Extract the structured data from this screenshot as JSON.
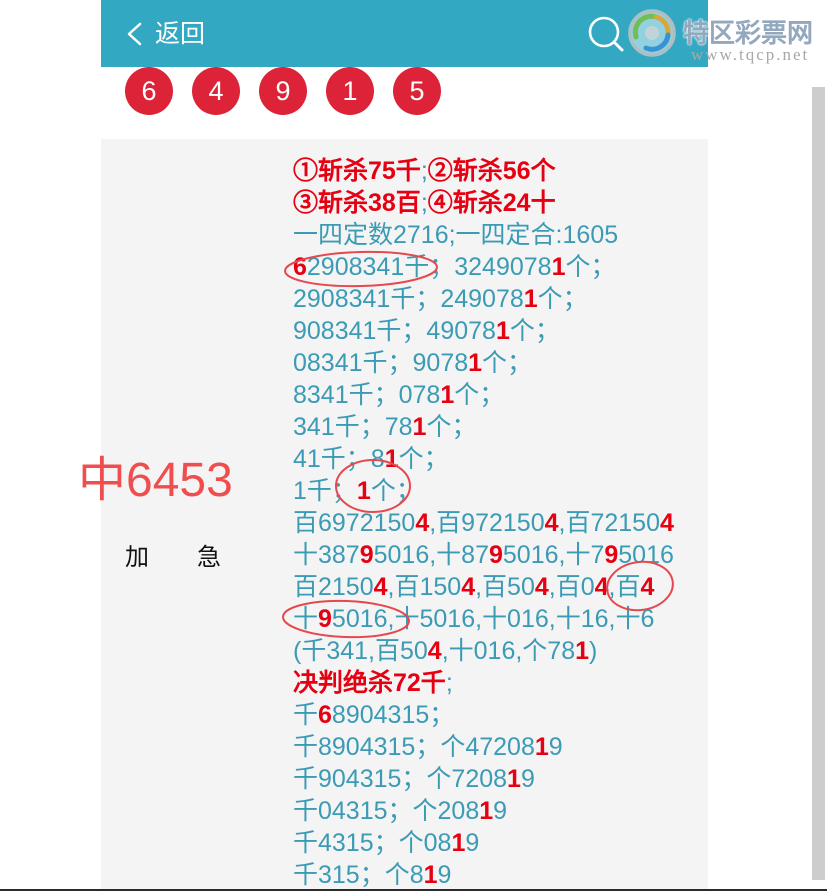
{
  "header": {
    "back_label": "返回"
  },
  "watermark": {
    "name": "特区彩票网",
    "url": "www.tqcp.net"
  },
  "icons": {
    "back": "chevron-left-icon",
    "search": "search-icon",
    "logo": "logo-icon"
  },
  "balls": [
    "6",
    "4",
    "9",
    "1",
    "5"
  ],
  "panel": {
    "label": "加　急",
    "stamp": "中6453",
    "lines": [
      [
        {
          "text": "①斩杀75千",
          "hl": true
        },
        {
          "text": ";",
          "hl": false
        },
        {
          "text": "②斩杀56个",
          "hl": true
        }
      ],
      [
        {
          "text": "③斩杀38百",
          "hl": true
        },
        {
          "text": ";",
          "hl": false
        },
        {
          "text": "④斩杀24十",
          "hl": true
        }
      ],
      [
        {
          "text": "一四定数2716;一四定合:1605",
          "hl": false
        }
      ],
      [
        {
          "text": "6",
          "hl": true
        },
        {
          "text": "2908341千；3249078",
          "hl": false
        },
        {
          "text": "1",
          "hl": true
        },
        {
          "text": "个；",
          "hl": false
        }
      ],
      [
        {
          "text": "2908341千；249078",
          "hl": false
        },
        {
          "text": "1",
          "hl": true
        },
        {
          "text": "个；",
          "hl": false
        }
      ],
      [
        {
          "text": "908341千；49078",
          "hl": false
        },
        {
          "text": "1",
          "hl": true
        },
        {
          "text": "个；",
          "hl": false
        }
      ],
      [
        {
          "text": "08341千；9078",
          "hl": false
        },
        {
          "text": "1",
          "hl": true
        },
        {
          "text": "个；",
          "hl": false
        }
      ],
      [
        {
          "text": "8341千；078",
          "hl": false
        },
        {
          "text": "1",
          "hl": true
        },
        {
          "text": "个；",
          "hl": false
        }
      ],
      [
        {
          "text": "341千；78",
          "hl": false
        },
        {
          "text": "1",
          "hl": true
        },
        {
          "text": "个；",
          "hl": false
        }
      ],
      [
        {
          "text": "41千；8",
          "hl": false
        },
        {
          "text": "1",
          "hl": true
        },
        {
          "text": "个；",
          "hl": false
        }
      ],
      [
        {
          "text": "1千；",
          "hl": false
        },
        {
          "text": "1",
          "hl": true
        },
        {
          "text": "个；",
          "hl": false
        }
      ],
      [
        {
          "text": "百6972150",
          "hl": false
        },
        {
          "text": "4",
          "hl": true
        },
        {
          "text": ",百972150",
          "hl": false
        },
        {
          "text": "4",
          "hl": true
        },
        {
          "text": ",百72150",
          "hl": false
        },
        {
          "text": "4",
          "hl": true
        }
      ],
      [
        {
          "text": "十387",
          "hl": false
        },
        {
          "text": "9",
          "hl": true
        },
        {
          "text": "5016,十87",
          "hl": false
        },
        {
          "text": "9",
          "hl": true
        },
        {
          "text": "5016,十7",
          "hl": false
        },
        {
          "text": "9",
          "hl": true
        },
        {
          "text": "5016",
          "hl": false
        }
      ],
      [
        {
          "text": "百2150",
          "hl": false
        },
        {
          "text": "4",
          "hl": true
        },
        {
          "text": ",百150",
          "hl": false
        },
        {
          "text": "4",
          "hl": true
        },
        {
          "text": ",百50",
          "hl": false
        },
        {
          "text": "4",
          "hl": true
        },
        {
          "text": ",百0",
          "hl": false
        },
        {
          "text": "4",
          "hl": true
        },
        {
          "text": ",百",
          "hl": false
        },
        {
          "text": "4",
          "hl": true
        }
      ],
      [
        {
          "text": "十",
          "hl": false
        },
        {
          "text": "9",
          "hl": true
        },
        {
          "text": "5016,十5016,十016,十16,十6",
          "hl": false
        }
      ],
      [
        {
          "text": "(千341,百50",
          "hl": false
        },
        {
          "text": "4",
          "hl": true
        },
        {
          "text": ",十016,个78",
          "hl": false
        },
        {
          "text": "1",
          "hl": true
        },
        {
          "text": ")",
          "hl": false
        }
      ],
      [
        {
          "text": "决判绝杀72千",
          "hl": true
        },
        {
          "text": ";",
          "hl": false
        }
      ],
      [
        {
          "text": "千",
          "hl": false
        },
        {
          "text": "6",
          "hl": true
        },
        {
          "text": "8904315；",
          "hl": false
        }
      ],
      [
        {
          "text": "千8904315；个47208",
          "hl": false
        },
        {
          "text": "1",
          "hl": true
        },
        {
          "text": "9",
          "hl": false
        }
      ],
      [
        {
          "text": "千904315；个7208",
          "hl": false
        },
        {
          "text": "1",
          "hl": true
        },
        {
          "text": "9",
          "hl": false
        }
      ],
      [
        {
          "text": "千04315；个208",
          "hl": false
        },
        {
          "text": "1",
          "hl": true
        },
        {
          "text": "9",
          "hl": false
        }
      ],
      [
        {
          "text": "千4315；个08",
          "hl": false
        },
        {
          "text": "1",
          "hl": true
        },
        {
          "text": "9",
          "hl": false
        }
      ],
      [
        {
          "text": "千315；个8",
          "hl": false
        },
        {
          "text": "1",
          "hl": true
        },
        {
          "text": "9",
          "hl": false
        }
      ]
    ]
  },
  "colors": {
    "header": "#33a8c2",
    "ball": "#dc2337",
    "text": "#3b9bb5",
    "highlight": "#e50012",
    "stamp": "#f04e4e",
    "annotation": "#e5484d",
    "panel": "#f4f4f4"
  }
}
